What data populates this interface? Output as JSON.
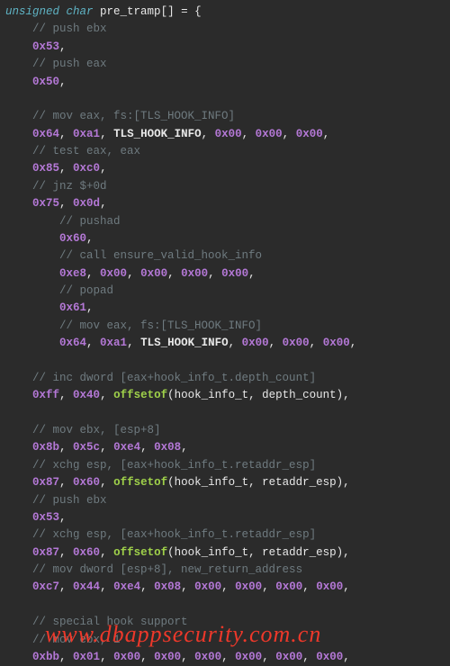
{
  "decl_keywords": "unsigned char",
  "decl_name": "pre_tramp",
  "decl_suffix": "[] = {",
  "lines": [
    {
      "indent": 1,
      "type": "comment",
      "text": "// push ebx"
    },
    {
      "indent": 1,
      "type": "hexline",
      "tokens": [
        "0x53"
      ],
      "trail": ","
    },
    {
      "indent": 1,
      "type": "comment",
      "text": "// push eax"
    },
    {
      "indent": 1,
      "type": "hexline",
      "tokens": [
        "0x50"
      ],
      "trail": ","
    },
    {
      "indent": 0,
      "type": "blank"
    },
    {
      "indent": 1,
      "type": "comment",
      "text": "// mov eax, fs:[TLS_HOOK_INFO]"
    },
    {
      "indent": 1,
      "type": "mixline",
      "tokens": [
        {
          "k": "hex",
          "v": "0x64"
        },
        {
          "k": "p",
          "v": ", "
        },
        {
          "k": "hex",
          "v": "0xa1"
        },
        {
          "k": "p",
          "v": ", "
        },
        {
          "k": "id",
          "v": "TLS_HOOK_INFO"
        },
        {
          "k": "p",
          "v": ", "
        },
        {
          "k": "hex",
          "v": "0x00"
        },
        {
          "k": "p",
          "v": ", "
        },
        {
          "k": "hex",
          "v": "0x00"
        },
        {
          "k": "p",
          "v": ", "
        },
        {
          "k": "hex",
          "v": "0x00"
        },
        {
          "k": "p",
          "v": ","
        }
      ]
    },
    {
      "indent": 1,
      "type": "comment",
      "text": "// test eax, eax"
    },
    {
      "indent": 1,
      "type": "hexline",
      "tokens": [
        "0x85",
        "0xc0"
      ],
      "trail": ","
    },
    {
      "indent": 1,
      "type": "comment",
      "text": "// jnz $+0d"
    },
    {
      "indent": 1,
      "type": "hexline",
      "tokens": [
        "0x75",
        "0x0d"
      ],
      "trail": ","
    },
    {
      "indent": 2,
      "type": "comment",
      "text": "// pushad"
    },
    {
      "indent": 2,
      "type": "hexline",
      "tokens": [
        "0x60"
      ],
      "trail": ","
    },
    {
      "indent": 2,
      "type": "comment",
      "text": "// call ensure_valid_hook_info"
    },
    {
      "indent": 2,
      "type": "hexline",
      "tokens": [
        "0xe8",
        "0x00",
        "0x00",
        "0x00",
        "0x00"
      ],
      "trail": ","
    },
    {
      "indent": 2,
      "type": "comment",
      "text": "// popad"
    },
    {
      "indent": 2,
      "type": "hexline",
      "tokens": [
        "0x61"
      ],
      "trail": ","
    },
    {
      "indent": 2,
      "type": "comment",
      "text": "// mov eax, fs:[TLS_HOOK_INFO]"
    },
    {
      "indent": 2,
      "type": "mixline",
      "tokens": [
        {
          "k": "hex",
          "v": "0x64"
        },
        {
          "k": "p",
          "v": ", "
        },
        {
          "k": "hex",
          "v": "0xa1"
        },
        {
          "k": "p",
          "v": ", "
        },
        {
          "k": "id",
          "v": "TLS_HOOK_INFO"
        },
        {
          "k": "p",
          "v": ", "
        },
        {
          "k": "hex",
          "v": "0x00"
        },
        {
          "k": "p",
          "v": ", "
        },
        {
          "k": "hex",
          "v": "0x00"
        },
        {
          "k": "p",
          "v": ", "
        },
        {
          "k": "hex",
          "v": "0x00"
        },
        {
          "k": "p",
          "v": ","
        }
      ]
    },
    {
      "indent": 0,
      "type": "blank"
    },
    {
      "indent": 1,
      "type": "comment",
      "text": "// inc dword [eax+hook_info_t.depth_count]"
    },
    {
      "indent": 1,
      "type": "mixline",
      "tokens": [
        {
          "k": "hex",
          "v": "0xff"
        },
        {
          "k": "p",
          "v": ", "
        },
        {
          "k": "hex",
          "v": "0x40"
        },
        {
          "k": "p",
          "v": ", "
        },
        {
          "k": "fn",
          "v": "offsetof"
        },
        {
          "k": "p",
          "v": "("
        },
        {
          "k": "typ",
          "v": "hook_info_t"
        },
        {
          "k": "p",
          "v": ", "
        },
        {
          "k": "fld",
          "v": "depth_count"
        },
        {
          "k": "p",
          "v": "),"
        }
      ]
    },
    {
      "indent": 0,
      "type": "blank"
    },
    {
      "indent": 1,
      "type": "comment",
      "text": "// mov ebx, [esp+8]"
    },
    {
      "indent": 1,
      "type": "hexline",
      "tokens": [
        "0x8b",
        "0x5c",
        "0xe4",
        "0x08"
      ],
      "trail": ","
    },
    {
      "indent": 1,
      "type": "comment",
      "text": "// xchg esp, [eax+hook_info_t.retaddr_esp]"
    },
    {
      "indent": 1,
      "type": "mixline",
      "tokens": [
        {
          "k": "hex",
          "v": "0x87"
        },
        {
          "k": "p",
          "v": ", "
        },
        {
          "k": "hex",
          "v": "0x60"
        },
        {
          "k": "p",
          "v": ", "
        },
        {
          "k": "fn",
          "v": "offsetof"
        },
        {
          "k": "p",
          "v": "("
        },
        {
          "k": "typ",
          "v": "hook_info_t"
        },
        {
          "k": "p",
          "v": ", "
        },
        {
          "k": "fld",
          "v": "retaddr_esp"
        },
        {
          "k": "p",
          "v": "),"
        }
      ]
    },
    {
      "indent": 1,
      "type": "comment",
      "text": "// push ebx"
    },
    {
      "indent": 1,
      "type": "hexline",
      "tokens": [
        "0x53"
      ],
      "trail": ","
    },
    {
      "indent": 1,
      "type": "comment",
      "text": "// xchg esp, [eax+hook_info_t.retaddr_esp]"
    },
    {
      "indent": 1,
      "type": "mixline",
      "tokens": [
        {
          "k": "hex",
          "v": "0x87"
        },
        {
          "k": "p",
          "v": ", "
        },
        {
          "k": "hex",
          "v": "0x60"
        },
        {
          "k": "p",
          "v": ", "
        },
        {
          "k": "fn",
          "v": "offsetof"
        },
        {
          "k": "p",
          "v": "("
        },
        {
          "k": "typ",
          "v": "hook_info_t"
        },
        {
          "k": "p",
          "v": ", "
        },
        {
          "k": "fld",
          "v": "retaddr_esp"
        },
        {
          "k": "p",
          "v": "),"
        }
      ]
    },
    {
      "indent": 1,
      "type": "comment",
      "text": "// mov dword [esp+8], new_return_address"
    },
    {
      "indent": 1,
      "type": "hexline",
      "tokens": [
        "0xc7",
        "0x44",
        "0xe4",
        "0x08",
        "0x00",
        "0x00",
        "0x00",
        "0x00"
      ],
      "trail": ","
    },
    {
      "indent": 0,
      "type": "blank"
    },
    {
      "indent": 1,
      "type": "comment",
      "text": "// special hook support"
    },
    {
      "indent": 1,
      "type": "comment",
      "text": "// mov ebx, 1"
    },
    {
      "indent": 1,
      "type": "hexline",
      "tokens": [
        "0xbb",
        "0x01",
        "0x00",
        "0x00",
        "0x00",
        "0x00",
        "0x00",
        "0x00"
      ],
      "trail": ","
    }
  ],
  "watermark": "www.dbappsecurity.com.cn"
}
